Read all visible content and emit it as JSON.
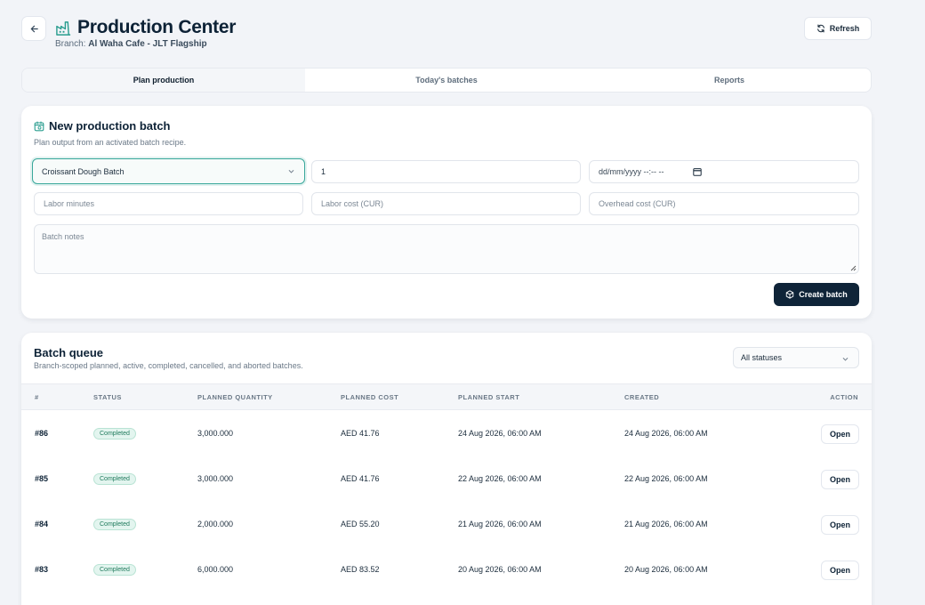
{
  "header": {
    "title": "Production Center",
    "branch_label": "Branch:",
    "branch_name": "Al Waha Cafe - JLT Flagship",
    "refresh_label": "Refresh"
  },
  "tabs": [
    {
      "label": "Plan production",
      "active": true
    },
    {
      "label": "Today's batches",
      "active": false
    },
    {
      "label": "Reports",
      "active": false
    }
  ],
  "new_batch": {
    "title": "New production batch",
    "description": "Plan output from an activated batch recipe.",
    "recipe_value": "Croissant Dough Batch",
    "quantity_value": "1",
    "datetime_placeholder": "dd/mm/yyyy --:-- --",
    "labor_minutes_placeholder": "Labor minutes",
    "labor_cost_placeholder": "Labor cost (CUR)",
    "overhead_cost_placeholder": "Overhead cost (CUR)",
    "notes_placeholder": "Batch notes",
    "create_label": "Create batch"
  },
  "queue": {
    "title": "Batch queue",
    "description": "Branch-scoped planned, active, completed, cancelled, and aborted batches.",
    "filter_value": "All statuses",
    "columns": [
      "#",
      "STATUS",
      "PLANNED QUANTITY",
      "PLANNED COST",
      "PLANNED START",
      "CREATED",
      "ACTION"
    ],
    "rows": [
      {
        "id": "#86",
        "status": "Completed",
        "quantity": "3,000.000",
        "cost": "AED 41.76",
        "start": "24 Aug 2026, 06:00 AM",
        "created": "24 Aug 2026, 06:00 AM",
        "action": "Open"
      },
      {
        "id": "#85",
        "status": "Completed",
        "quantity": "3,000.000",
        "cost": "AED 41.76",
        "start": "22 Aug 2026, 06:00 AM",
        "created": "22 Aug 2026, 06:00 AM",
        "action": "Open"
      },
      {
        "id": "#84",
        "status": "Completed",
        "quantity": "2,000.000",
        "cost": "AED 55.20",
        "start": "21 Aug 2026, 06:00 AM",
        "created": "21 Aug 2026, 06:00 AM",
        "action": "Open"
      },
      {
        "id": "#83",
        "status": "Completed",
        "quantity": "6,000.000",
        "cost": "AED 83.52",
        "start": "20 Aug 2026, 06:00 AM",
        "created": "20 Aug 2026, 06:00 AM",
        "action": "Open"
      }
    ]
  },
  "colors": {
    "accent": "#3aa89b",
    "primary_button": "#0f2438",
    "badge_bg": "#e3f5ef",
    "badge_text": "#1f7a5c"
  },
  "icons": [
    "back-arrow-icon",
    "factory-icon",
    "refresh-icon",
    "calendar-icon",
    "chevron-down-icon",
    "box-icon"
  ]
}
